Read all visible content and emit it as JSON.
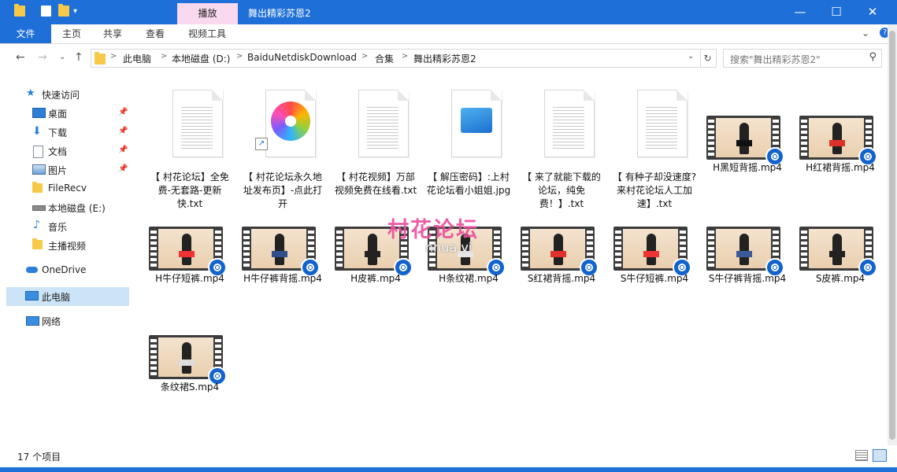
{
  "titlebar": {
    "context_tab": "播放",
    "window_title": "舞出精彩苏恩2",
    "minimize_icon": "minimize-icon",
    "maximize_icon": "maximize-icon",
    "close_icon": "close-icon"
  },
  "ribbon": {
    "tabs": [
      "文件",
      "主页",
      "共享",
      "查看",
      "视频工具"
    ]
  },
  "address": {
    "crumbs": [
      "此电脑",
      "本地磁盘 (D:)",
      "BaiduNetdiskDownload",
      "合集",
      "舞出精彩苏恩2"
    ],
    "search_placeholder": "搜索\"舞出精彩苏恩2\""
  },
  "navpane": {
    "items": [
      {
        "label": "快速访问",
        "icon": "star-icon"
      },
      {
        "label": "桌面",
        "icon": "desktop-icon"
      },
      {
        "label": "下载",
        "icon": "download-arrow-icon"
      },
      {
        "label": "文档",
        "icon": "document-icon"
      },
      {
        "label": "图片",
        "icon": "picture-icon"
      },
      {
        "label": "FileRecv",
        "icon": "folder-icon"
      },
      {
        "label": "本地磁盘 (E:)",
        "icon": "drive-icon"
      },
      {
        "label": "音乐",
        "icon": "music-note-icon"
      },
      {
        "label": "主播视频",
        "icon": "folder-icon"
      },
      {
        "label": "OneDrive",
        "icon": "cloud-icon"
      },
      {
        "label": "此电脑",
        "icon": "computer-icon"
      },
      {
        "label": "网络",
        "icon": "network-icon"
      }
    ]
  },
  "files": [
    {
      "name": "【 村花论坛】全免费-无套路-更新快.txt",
      "kind": "txt"
    },
    {
      "name": "【 村花论坛永久地址发布页】-点此打开",
      "kind": "shortcut"
    },
    {
      "name": "【 村花视频】万部视频免费在线看.txt",
      "kind": "txt"
    },
    {
      "name": "【 解压密码】:上村花论坛看小姐姐.jpg",
      "kind": "jpg"
    },
    {
      "name": "【 来了就能下载的论坛，纯免费！】.txt",
      "kind": "txt"
    },
    {
      "name": "【 有种子却没速度? 来村花论坛人工加速】.txt",
      "kind": "txt"
    },
    {
      "name": "H黑短背摇.mp4",
      "kind": "mp4"
    },
    {
      "name": "H红裙背摇.mp4",
      "kind": "mp4"
    },
    {
      "name": "H牛仔短裤.mp4",
      "kind": "mp4"
    },
    {
      "name": "H牛仔裤背摇.mp4",
      "kind": "mp4"
    },
    {
      "name": "H皮裤.mp4",
      "kind": "mp4"
    },
    {
      "name": "H条纹裙.mp4",
      "kind": "mp4"
    },
    {
      "name": "S红裙背摇.mp4",
      "kind": "mp4"
    },
    {
      "name": "S牛仔短裤.mp4",
      "kind": "mp4"
    },
    {
      "name": "S牛仔裤背摇.mp4",
      "kind": "mp4"
    },
    {
      "name": "S皮裤.mp4",
      "kind": "mp4"
    },
    {
      "name": "条纹裙S.mp4",
      "kind": "mp4"
    }
  ],
  "watermark": {
    "text": "村花论坛",
    "sub": "nhua.vi"
  },
  "status": {
    "count": "17 个项目"
  },
  "colors": {
    "accent": "#1e6fd8",
    "context_tab": "#f9d9ee",
    "selected_nav": "#cce4f7"
  }
}
